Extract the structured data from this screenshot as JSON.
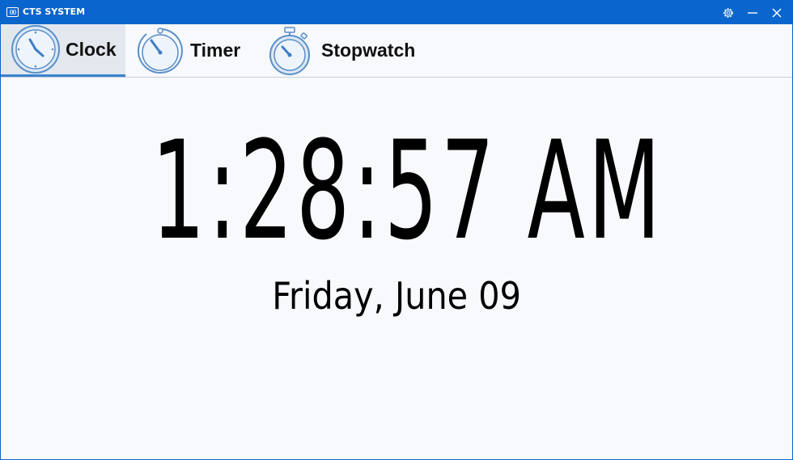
{
  "window": {
    "title": "CTS SYSTEM",
    "app_icon_text": "00",
    "accent_color": "#0a66cc",
    "controls": {
      "settings": "gear-icon",
      "minimize": "minimize-icon",
      "close": "close-icon"
    }
  },
  "tabs": [
    {
      "label": "Clock",
      "icon": "clock-icon",
      "selected": true
    },
    {
      "label": "Timer",
      "icon": "timer-icon",
      "selected": false
    },
    {
      "label": "Stopwatch",
      "icon": "stopwatch-icon",
      "selected": false
    }
  ],
  "clock": {
    "time": "1:28:57 AM",
    "date": "Friday, June 09"
  }
}
